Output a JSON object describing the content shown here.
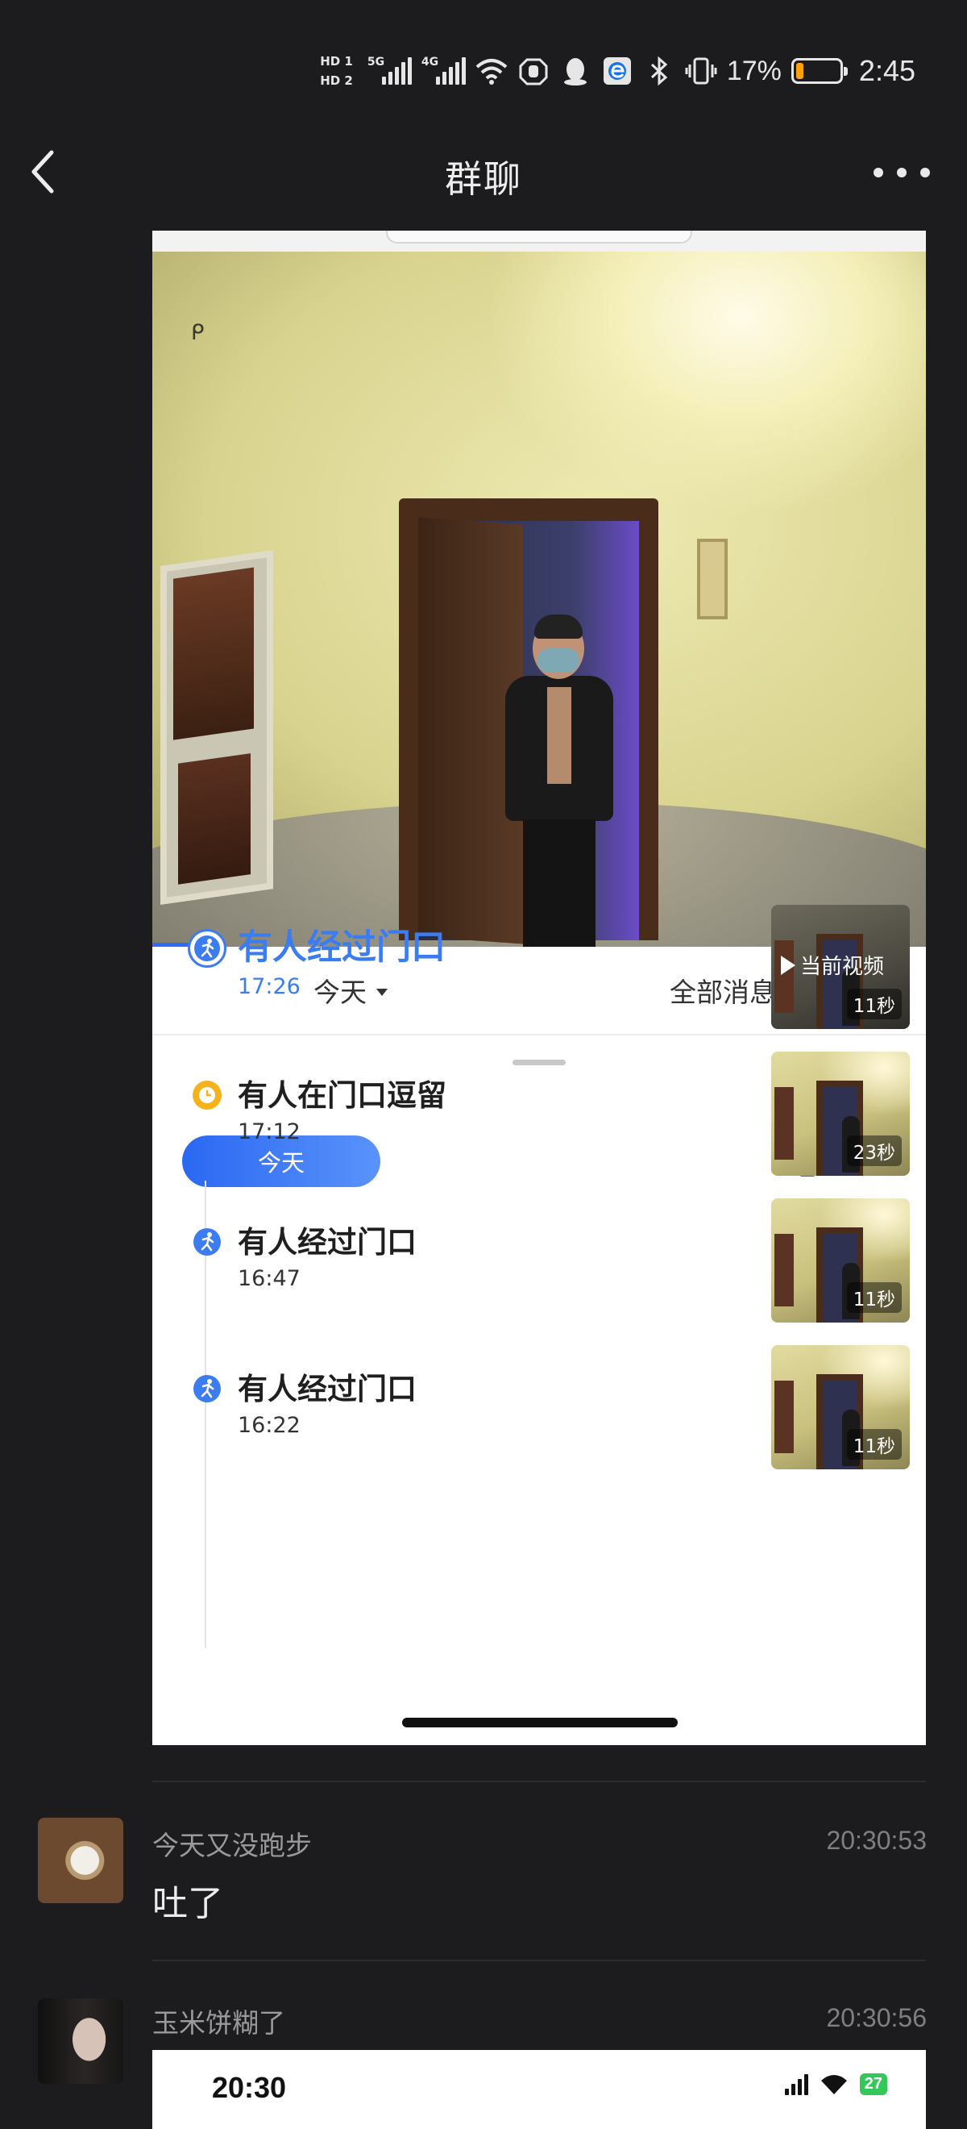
{
  "status_bar": {
    "hd1": "HD 1",
    "hd2": "HD 2",
    "net1": "5G",
    "net2": "4G",
    "battery_pct": "17%",
    "battery_level": 0.17,
    "time": "2:45",
    "icons": [
      "wifi-icon",
      "hand-icon",
      "qq-penguin-icon",
      "browser-icon",
      "bluetooth-icon",
      "vibrate-icon",
      "battery-icon"
    ]
  },
  "header": {
    "title": "群聊",
    "back_icon": "chevron-left-icon",
    "more_icon": "more-dots-icon"
  },
  "shared_screenshot": {
    "filter": {
      "date_label": "今天",
      "type_label": "全部消息"
    },
    "today_pill": "今天",
    "events": [
      {
        "name": "有人经过门口",
        "time": "17:26",
        "kind": "walk",
        "thumb_label": "当前视频",
        "duration": "11秒",
        "active": true
      },
      {
        "name": "有人在门口逗留",
        "time": "17:12",
        "kind": "linger",
        "duration": "23秒",
        "active": false
      },
      {
        "name": "有人经过门口",
        "time": "16:47",
        "kind": "walk",
        "duration": "11秒",
        "active": false
      },
      {
        "name": "有人经过门口",
        "time": "16:22",
        "kind": "walk",
        "duration": "11秒",
        "active": false
      }
    ],
    "colors": {
      "accent": "#3b7cf0",
      "linger": "#f5b21b"
    }
  },
  "messages": [
    {
      "sender": "今天又没跑步",
      "time": "20:30:53",
      "text": "吐了"
    },
    {
      "sender": "玉米饼糊了",
      "time": "20:30:56"
    }
  ],
  "shared_screenshot_2": {
    "time": "20:30",
    "battery": "27"
  }
}
